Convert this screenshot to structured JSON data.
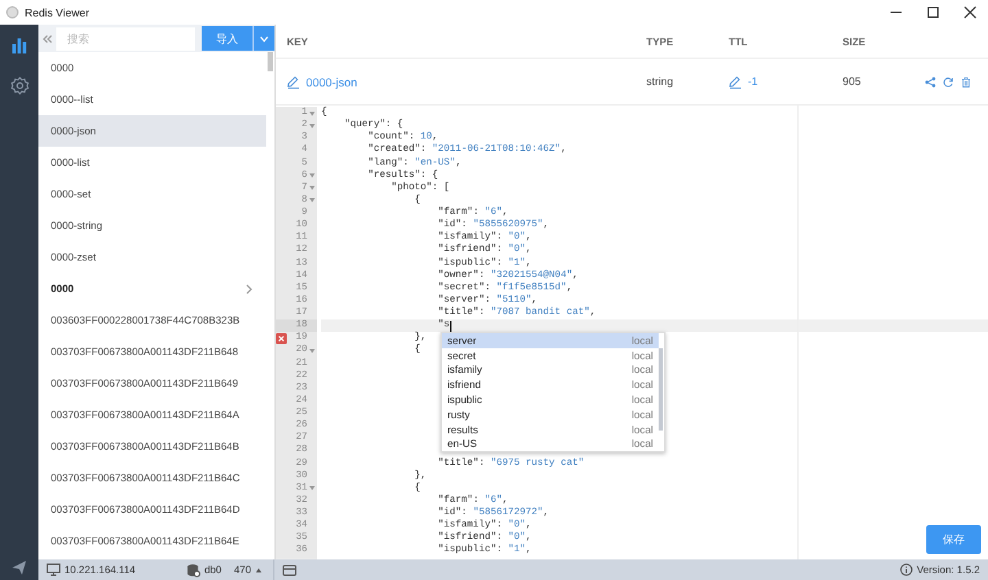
{
  "window": {
    "title": "Redis Viewer"
  },
  "sidebar": {
    "items": [
      {
        "kind": "chart",
        "selected": true
      },
      {
        "kind": "settings",
        "selected": false
      },
      {
        "kind": "send",
        "selected": false
      }
    ]
  },
  "search": {
    "placeholder": "搜索"
  },
  "import_button": {
    "label": "导入"
  },
  "keys": [
    {
      "label": "0000",
      "kind": "key",
      "selected": false
    },
    {
      "label": "0000--list",
      "kind": "key",
      "selected": false
    },
    {
      "label": "0000-json",
      "kind": "key",
      "selected": true
    },
    {
      "label": "0000-list",
      "kind": "key",
      "selected": false
    },
    {
      "label": "0000-set",
      "kind": "key",
      "selected": false
    },
    {
      "label": "0000-string",
      "kind": "key",
      "selected": false
    },
    {
      "label": "0000-zset",
      "kind": "key",
      "selected": false
    },
    {
      "label": "0000",
      "kind": "folder",
      "selected": false
    },
    {
      "label": "003603FF000228001738F44C708B323B",
      "kind": "key",
      "selected": false
    },
    {
      "label": "003703FF00673800A001143DF211B648",
      "kind": "key",
      "selected": false
    },
    {
      "label": "003703FF00673800A001143DF211B649",
      "kind": "key",
      "selected": false
    },
    {
      "label": "003703FF00673800A001143DF211B64A",
      "kind": "key",
      "selected": false
    },
    {
      "label": "003703FF00673800A001143DF211B64B",
      "kind": "key",
      "selected": false
    },
    {
      "label": "003703FF00673800A001143DF211B64C",
      "kind": "key",
      "selected": false
    },
    {
      "label": "003703FF00673800A001143DF211B64D",
      "kind": "key",
      "selected": false
    },
    {
      "label": "003703FF00673800A001143DF211B64E",
      "kind": "key",
      "selected": false
    }
  ],
  "detail": {
    "columns": [
      "KEY",
      "TYPE",
      "TTL",
      "SIZE"
    ],
    "key": "0000-json",
    "type": "string",
    "ttl": "-1",
    "size": "905"
  },
  "editor": {
    "lines": [
      {
        "n": "1",
        "fold": true,
        "error": false,
        "current": false,
        "text": "{"
      },
      {
        "n": "2",
        "fold": true,
        "error": false,
        "current": false,
        "text": "    \"query\": {"
      },
      {
        "n": "3",
        "fold": false,
        "error": false,
        "current": false,
        "text": "        \"count\": 10,"
      },
      {
        "n": "4",
        "fold": false,
        "error": false,
        "current": false,
        "text": "        \"created\": \"2011-06-21T08:10:46Z\","
      },
      {
        "n": "5",
        "fold": false,
        "error": false,
        "current": false,
        "text": "        \"lang\": \"en-US\","
      },
      {
        "n": "6",
        "fold": true,
        "error": false,
        "current": false,
        "text": "        \"results\": {"
      },
      {
        "n": "7",
        "fold": true,
        "error": false,
        "current": false,
        "text": "            \"photo\": ["
      },
      {
        "n": "8",
        "fold": true,
        "error": false,
        "current": false,
        "text": "                {"
      },
      {
        "n": "9",
        "fold": false,
        "error": false,
        "current": false,
        "text": "                    \"farm\": \"6\","
      },
      {
        "n": "10",
        "fold": false,
        "error": false,
        "current": false,
        "text": "                    \"id\": \"5855620975\","
      },
      {
        "n": "11",
        "fold": false,
        "error": false,
        "current": false,
        "text": "                    \"isfamily\": \"0\","
      },
      {
        "n": "12",
        "fold": false,
        "error": false,
        "current": false,
        "text": "                    \"isfriend\": \"0\","
      },
      {
        "n": "13",
        "fold": false,
        "error": false,
        "current": false,
        "text": "                    \"ispublic\": \"1\","
      },
      {
        "n": "14",
        "fold": false,
        "error": false,
        "current": false,
        "text": "                    \"owner\": \"32021554@N04\","
      },
      {
        "n": "15",
        "fold": false,
        "error": false,
        "current": false,
        "text": "                    \"secret\": \"f1f5e8515d\","
      },
      {
        "n": "16",
        "fold": false,
        "error": false,
        "current": false,
        "text": "                    \"server\": \"5110\","
      },
      {
        "n": "17",
        "fold": false,
        "error": false,
        "current": false,
        "text": "                    \"title\": \"7087 bandit cat\","
      },
      {
        "n": "18",
        "fold": false,
        "error": false,
        "current": true,
        "text": "                    \"s"
      },
      {
        "n": "19",
        "fold": false,
        "error": true,
        "current": false,
        "text": "                },"
      },
      {
        "n": "20",
        "fold": true,
        "error": false,
        "current": false,
        "text": "                {"
      },
      {
        "n": "21",
        "fold": false,
        "error": false,
        "current": false
      },
      {
        "n": "22",
        "fold": false,
        "error": false,
        "current": false
      },
      {
        "n": "23",
        "fold": false,
        "error": false,
        "current": false
      },
      {
        "n": "24",
        "fold": false,
        "error": false,
        "current": false
      },
      {
        "n": "25",
        "fold": false,
        "error": false,
        "current": false
      },
      {
        "n": "26",
        "fold": false,
        "error": false,
        "current": false
      },
      {
        "n": "27",
        "fold": false,
        "error": false,
        "current": false
      },
      {
        "n": "28",
        "fold": false,
        "error": false,
        "current": false
      },
      {
        "n": "29",
        "fold": false,
        "error": false,
        "current": false,
        "text": "                    \"title\": \"6975 rusty cat\""
      },
      {
        "n": "30",
        "fold": false,
        "error": false,
        "current": false,
        "text": "                },"
      },
      {
        "n": "31",
        "fold": true,
        "error": false,
        "current": false,
        "text": "                {"
      },
      {
        "n": "32",
        "fold": false,
        "error": false,
        "current": false,
        "text": "                    \"farm\": \"6\","
      },
      {
        "n": "33",
        "fold": false,
        "error": false,
        "current": false,
        "text": "                    \"id\": \"5856172972\","
      },
      {
        "n": "34",
        "fold": false,
        "error": false,
        "current": false,
        "text": "                    \"isfamily\": \"0\","
      },
      {
        "n": "35",
        "fold": false,
        "error": false,
        "current": false,
        "text": "                    \"isfriend\": \"0\","
      },
      {
        "n": "36",
        "fold": false,
        "error": false,
        "current": false,
        "text": "                    \"ispublic\": \"1\","
      }
    ],
    "autocomplete": [
      {
        "label": "server",
        "source": "local",
        "selected": true
      },
      {
        "label": "secret",
        "source": "local",
        "selected": false
      },
      {
        "label": "isfamily",
        "source": "local",
        "selected": false
      },
      {
        "label": "isfriend",
        "source": "local",
        "selected": false
      },
      {
        "label": "ispublic",
        "source": "local",
        "selected": false
      },
      {
        "label": "rusty",
        "source": "local",
        "selected": false
      },
      {
        "label": "results",
        "source": "local",
        "selected": false
      },
      {
        "label": "en-US",
        "source": "local",
        "selected": false
      }
    ]
  },
  "save_button": {
    "label": "保存"
  },
  "status_bar": {
    "host": "10.221.164.114",
    "db": "db0",
    "count": "470",
    "version": "Version: 1.5.2"
  }
}
